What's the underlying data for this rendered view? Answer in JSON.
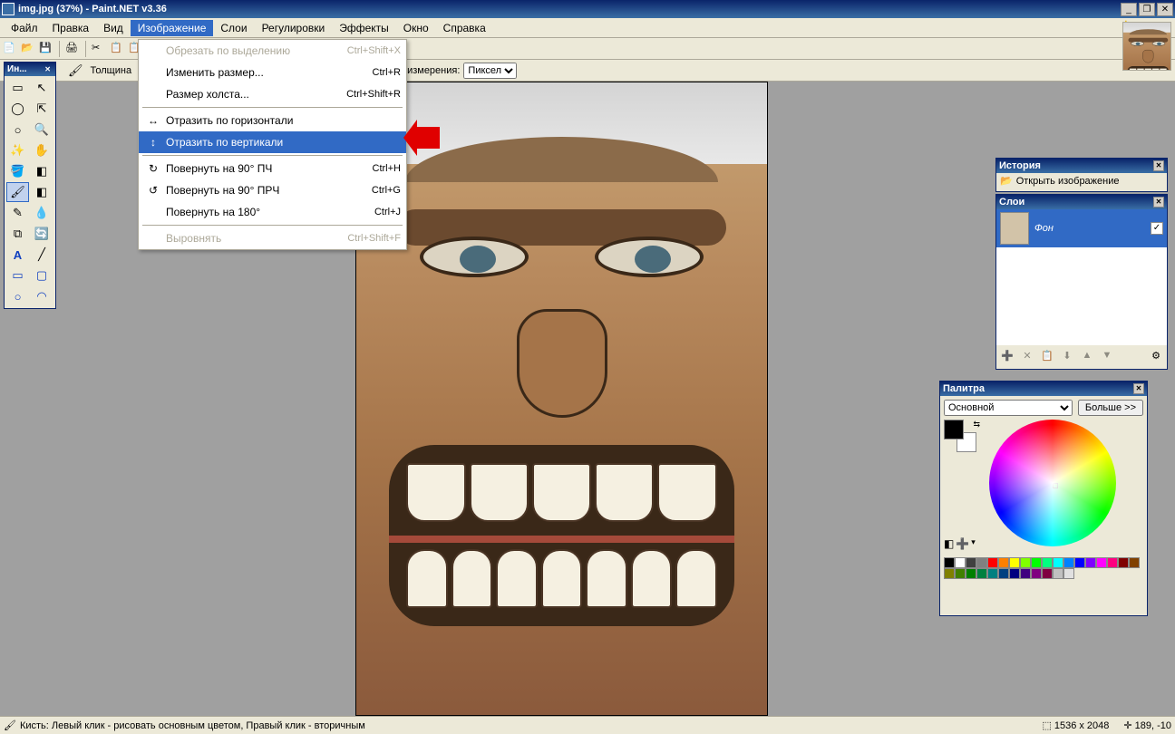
{
  "titlebar": {
    "text": "img.jpg (37%) - Paint.NET v3.36"
  },
  "menubar": {
    "items": [
      "Файл",
      "Правка",
      "Вид",
      "Изображение",
      "Слои",
      "Регулировки",
      "Эффекты",
      "Окно",
      "Справка"
    ],
    "active_index": 3
  },
  "toolbar2": {
    "width_label": "Толщина",
    "unit_label": "измерения:",
    "unit_value": "Пиксел"
  },
  "dropdown": {
    "items": [
      {
        "icon": "",
        "label": "Обрезать по выделению",
        "shortcut": "Ctrl+Shift+X",
        "disabled": true
      },
      {
        "icon": "",
        "label": "Изменить размер...",
        "shortcut": "Ctrl+R"
      },
      {
        "icon": "",
        "label": "Размер холста...",
        "shortcut": "Ctrl+Shift+R"
      },
      {
        "sep": true
      },
      {
        "icon": "↔",
        "label": "Отразить по горизонтали",
        "shortcut": ""
      },
      {
        "icon": "↕",
        "label": "Отразить по вертикали",
        "shortcut": "",
        "hover": true
      },
      {
        "sep": true
      },
      {
        "icon": "↻",
        "label": "Повернуть на 90° ПЧ",
        "shortcut": "Ctrl+H"
      },
      {
        "icon": "↺",
        "label": "Повернуть на 90° ПРЧ",
        "shortcut": "Ctrl+G"
      },
      {
        "icon": "",
        "label": "Повернуть на 180°",
        "shortcut": "Ctrl+J"
      },
      {
        "sep": true
      },
      {
        "icon": "",
        "label": "Выровнять",
        "shortcut": "Ctrl+Shift+F",
        "disabled": true
      }
    ]
  },
  "tools_panel": {
    "title": "Ин..."
  },
  "history": {
    "title": "История",
    "entry": "Открыть изображение"
  },
  "layers": {
    "title": "Слои",
    "item": "Фон"
  },
  "palette": {
    "title": "Палитра",
    "select": "Основной",
    "more": "Больше >>",
    "colors": [
      "#000000",
      "#ffffff",
      "#404040",
      "#808080",
      "#ff0000",
      "#ff8000",
      "#ffff00",
      "#80ff00",
      "#00ff00",
      "#00ff80",
      "#00ffff",
      "#0080ff",
      "#0000ff",
      "#8000ff",
      "#ff00ff",
      "#ff0080",
      "#800000",
      "#804000",
      "#808000",
      "#408000",
      "#008000",
      "#008040",
      "#008080",
      "#004080",
      "#000080",
      "#400080",
      "#800080",
      "#800040",
      "#c0c0c0",
      "#e0e0e0"
    ]
  },
  "statusbar": {
    "text": "Кисть: Левый клик - рисовать основным цветом, Правый клик - вторичным",
    "dims": "1536 x 2048",
    "coords": "189, -10"
  }
}
